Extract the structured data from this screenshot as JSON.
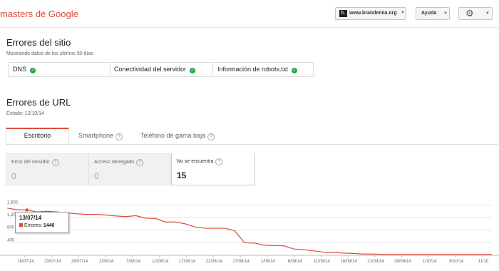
{
  "header": {
    "brand": "masters de Google",
    "site_name": "www.brandemia.org",
    "help_label": "Ayuda"
  },
  "site_errors": {
    "title": "Errores del sitio",
    "subtitle": "Mostrando datos de los últimos 90 días",
    "checks": [
      {
        "label": "DNS",
        "status": "ok"
      },
      {
        "label": "Conectividad del servidor",
        "status": "ok"
      },
      {
        "label": "Información de robots.txt",
        "status": "ok"
      }
    ]
  },
  "url_errors": {
    "title": "Errores de URL",
    "status": "Estado: 12/10/14",
    "tabs": [
      {
        "label": "Escritorio",
        "active": true,
        "help": false
      },
      {
        "label": "Smartphone",
        "active": false,
        "help": true
      },
      {
        "label": "Teléfono de gama baja",
        "active": false,
        "help": true
      }
    ],
    "metrics": [
      {
        "label": "Error del servidor",
        "value": "0",
        "active": false
      },
      {
        "label": "Acceso denegado",
        "value": "0",
        "active": false
      },
      {
        "label": "No se encuentra",
        "value": "15",
        "active": true
      }
    ]
  },
  "colors": {
    "accent": "#dd4b39",
    "ok": "#2aa34c"
  },
  "chart_data": {
    "type": "line",
    "title": "",
    "xlabel": "",
    "ylabel": "",
    "y_ticks": [
      "1,600",
      "1,200",
      "800",
      "400"
    ],
    "ylim": [
      0,
      1700
    ],
    "x_tick_labels": [
      "18/07/14",
      "23/07/14",
      "28/07/14",
      "2/08/14",
      "7/08/14",
      "12/08/14",
      "17/08/14",
      "22/08/14",
      "27/08/14",
      "1/09/14",
      "6/09/14",
      "11/09/14",
      "16/09/14",
      "21/09/14",
      "26/09/14",
      "1/10/14",
      "6/10/14",
      "11/10"
    ],
    "series": [
      {
        "name": "Errores",
        "color": "#dd4b39",
        "values": [
          1500,
          1450,
          1440,
          1380,
          1400,
          1380,
          1350,
          1320,
          1300,
          1300,
          1280,
          1250,
          1230,
          1260,
          1180,
          1170,
          1060,
          1060,
          1000,
          900,
          860,
          860,
          860,
          780,
          400,
          390,
          320,
          310,
          300,
          200,
          180,
          140,
          100,
          90,
          70,
          60,
          40,
          40,
          30,
          30,
          30,
          30,
          30,
          30,
          30,
          30,
          30,
          30,
          30,
          30
        ]
      }
    ],
    "tooltip": {
      "date": "13/07/14",
      "series": "Errores",
      "value": "1440"
    }
  }
}
